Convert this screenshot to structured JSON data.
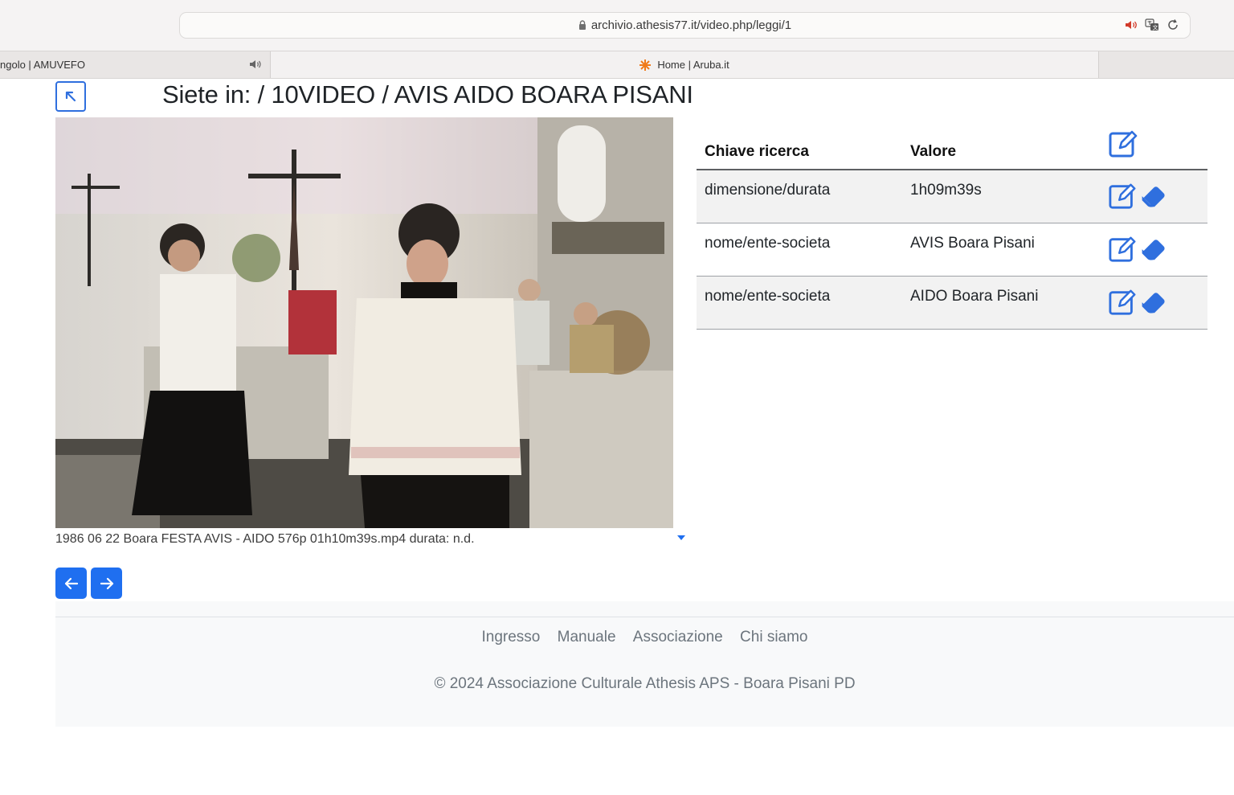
{
  "browser": {
    "url": "archivio.athesis77.it/video.php/leggi/1",
    "tabs": [
      {
        "label": "ngolo | AMUVEFO"
      },
      {
        "label": "Home | Aruba.it"
      }
    ]
  },
  "page": {
    "breadcrumb": "Siete in: / 10VIDEO / AVIS AIDO BOARA PISANI",
    "video_caption": "1986 06 22 Boara FESTA AVIS - AIDO 576p 01h10m39s.mp4 durata: n.d."
  },
  "table": {
    "headers": {
      "key": "Chiave ricerca",
      "value": "Valore"
    },
    "rows": [
      {
        "key": "dimensione/durata",
        "value": "1h09m39s"
      },
      {
        "key": "nome/ente-societa",
        "value": "AVIS Boara Pisani"
      },
      {
        "key": "nome/ente-societa",
        "value": "AIDO Boara Pisani"
      }
    ]
  },
  "footer": {
    "links": [
      "Ingresso",
      "Manuale",
      "Associazione",
      "Chi siamo"
    ],
    "copyright": "© 2024 Associazione Culturale Athesis APS - Boara Pisani PD"
  },
  "colors": {
    "accent": "#1f6ff0",
    "chrome": "#f5f3f3",
    "footer_bg": "#f8f9fa"
  },
  "icons": {
    "back": "arrow-up-left-square-icon",
    "edit": "pencil-square-icon",
    "delete": "eraser-icon",
    "prev": "arrow-left-icon",
    "next": "arrow-right-icon"
  }
}
